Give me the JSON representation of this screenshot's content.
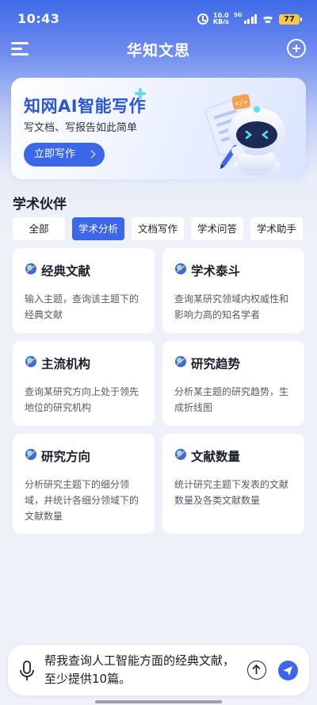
{
  "status_bar": {
    "time": "10:43",
    "net_speed_value": "10.0",
    "net_speed_unit": "KB/s",
    "network_type": "5G",
    "battery": "77"
  },
  "header": {
    "title": "华知文思"
  },
  "banner": {
    "title": "知网AI智能写作",
    "subtitle": "写文档、写报告如此简单",
    "button_label": "立即写作"
  },
  "section": {
    "title": "学术伙伴"
  },
  "tabs": [
    {
      "label": "全部",
      "active": false
    },
    {
      "label": "学术分析",
      "active": true
    },
    {
      "label": "文档写作",
      "active": false
    },
    {
      "label": "学术问答",
      "active": false
    },
    {
      "label": "学术助手",
      "active": false
    }
  ],
  "cards": [
    {
      "title": "经典文献",
      "desc": "输入主题，查询该主题下的经典文献"
    },
    {
      "title": "学术泰斗",
      "desc": "查询某研究领域内权威性和影响力高的知名学者"
    },
    {
      "title": "主流机构",
      "desc": "查询某研究方向上处于领先地位的研究机构"
    },
    {
      "title": "研究趋势",
      "desc": "分析某主题的研究趋势，生成折线图"
    },
    {
      "title": "研究方向",
      "desc": "分析研究主题下的细分领域，并统计各细分领域下的文献数量"
    },
    {
      "title": "文献数量",
      "desc": "统计研究主题下发表的文献数量及各类文献数量"
    }
  ],
  "input": {
    "value": "帮我查询人工智能方面的经典文献，至少提供10篇。"
  },
  "colors": {
    "accent": "#3c67e8",
    "banner_title": "#2b55d8",
    "page_background": "#eef1f7"
  }
}
